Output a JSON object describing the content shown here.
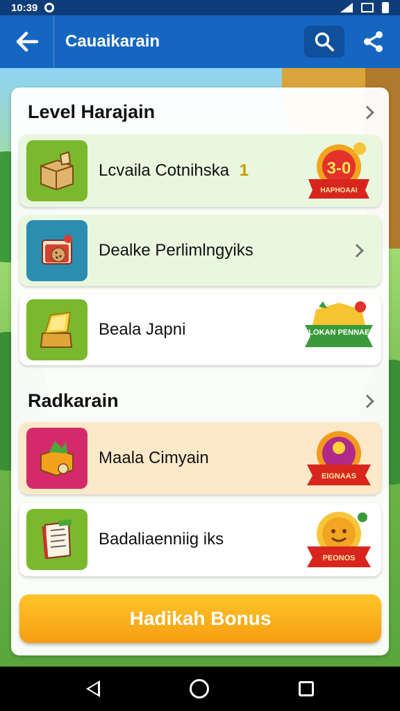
{
  "status_bar": {
    "time": "10:39"
  },
  "app_bar": {
    "title": "Cauaikarain"
  },
  "section1": {
    "title": "Level Harajain",
    "items": [
      {
        "label": "Lcvaila Cotnihska",
        "suffix": "1",
        "badge_text": "3-0",
        "badge_ribbon": "HAPHOAAI"
      },
      {
        "label": "Dealke Perlimlngyiks"
      },
      {
        "label": "Beala Japni",
        "badge_ribbon": "PLOKAN PENNAEL"
      }
    ]
  },
  "section2": {
    "title": "Radkarain",
    "items": [
      {
        "label": "Maala Cimyain",
        "badge_ribbon": "EIGNAAS"
      },
      {
        "label": "Badaliaenniig iks",
        "badge_ribbon": "PEONOS"
      }
    ]
  },
  "bonus_button": {
    "label": "Hadikah Bonus"
  },
  "colors": {
    "primary": "#1566c0",
    "status_bar": "#0f3d7a",
    "bonus": "#f5a81a"
  }
}
